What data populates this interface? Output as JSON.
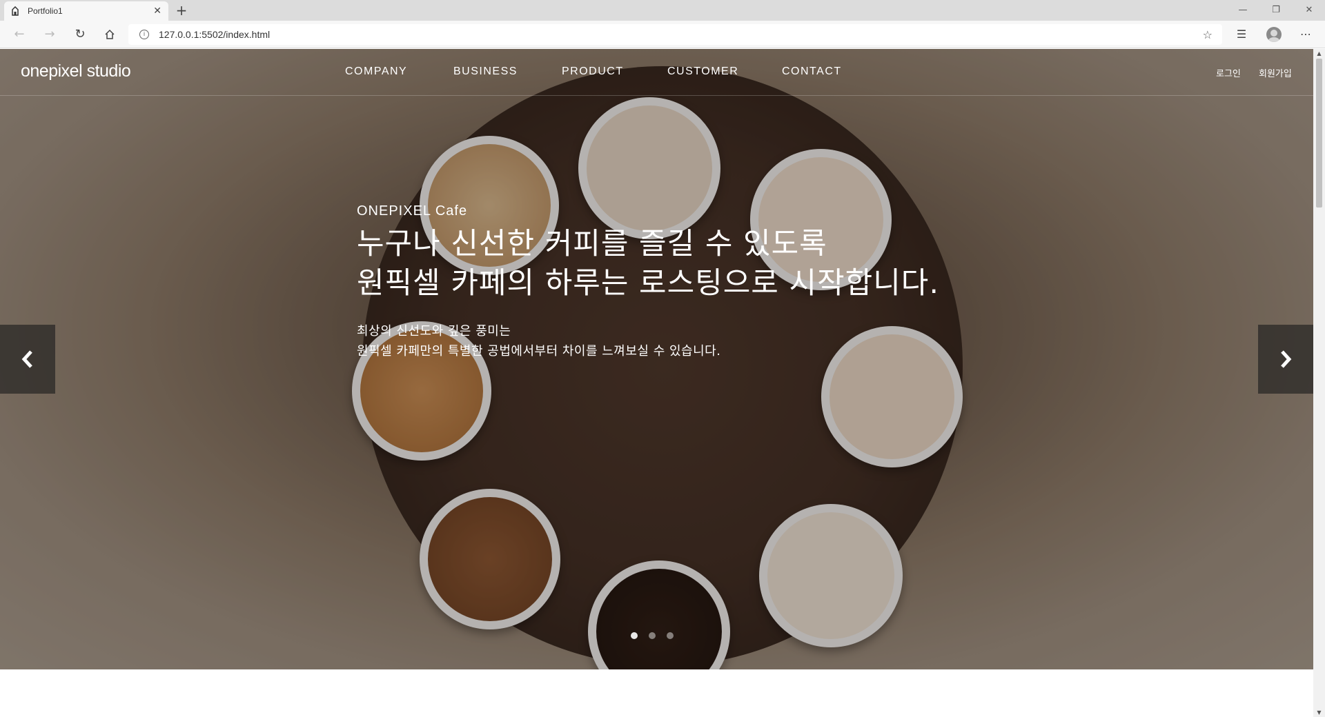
{
  "browser": {
    "tab_title": "Portfolio1",
    "url": "127.0.0.1:5502/index.html"
  },
  "site": {
    "logo": "onepixel studio",
    "nav": [
      "COMPANY",
      "BUSINESS",
      "PRODUCT",
      "CUSTOMER",
      "CONTACT"
    ],
    "util": {
      "login": "로그인",
      "signup": "회원가입"
    }
  },
  "hero": {
    "eyebrow": "ONEPIXEL Cafe",
    "headline": [
      "누구나 신선한 커피를 즐길 수 있도록",
      "원픽셀 카페의 하루는 로스팅으로 시작합니다."
    ],
    "subcopy": [
      "최상의 신선도와 깊은 풍미는",
      "원픽셀 카페만의 특별한 공법에서부터 차이를 느껴보실 수 있습니다."
    ],
    "slide_count": 3,
    "active_slide": 1
  },
  "colors": {
    "overlay_text": "#ffffff",
    "button_bg": "#1e1e1e"
  }
}
